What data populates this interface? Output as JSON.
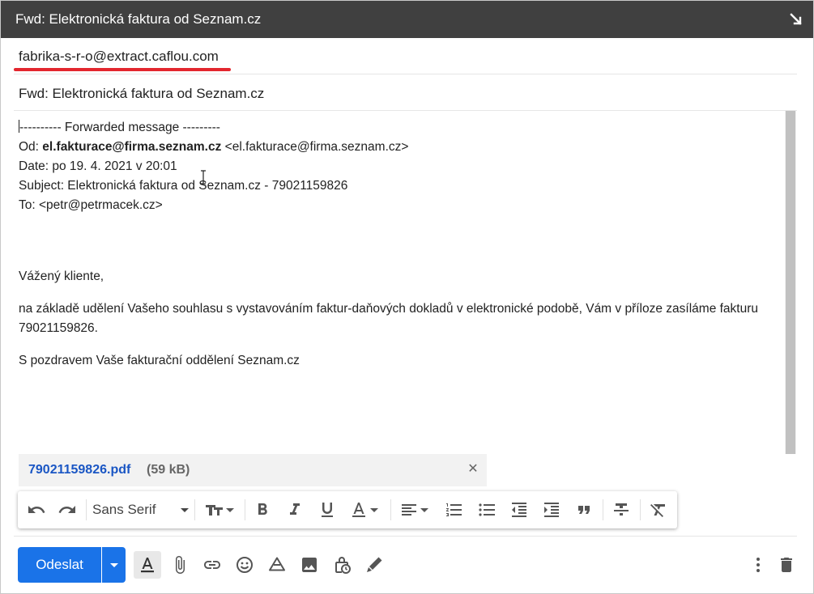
{
  "window": {
    "title": "Fwd: Elektronická faktura od Seznam.cz"
  },
  "recipient": {
    "value": "fabrika-s-r-o@extract.caflou.com"
  },
  "subject": {
    "value": "Fwd: Elektronická faktura od Seznam.cz"
  },
  "body": {
    "forward_header": "---------- Forwarded message ---------",
    "from_label": "Od:",
    "from_name": "el.fakturace@firma.seznam.cz",
    "from_email": "<el.fakturace@firma.seznam.cz>",
    "date_line": "Date: po 19. 4. 2021 v 20:01",
    "subject_line": "Subject: Elektronická faktura od Seznam.cz - 79021159826",
    "to_line": "To: <petr@petrmacek.cz>",
    "greeting": "Vážený kliente,",
    "paragraph": "na základě udělení Vašeho souhlasu s vystavováním faktur-daňových dokladů v elektronické podobě, Vám v příloze zasíláme fakturu 79021159826.",
    "closing": "S pozdravem Vaše fakturační oddělení Seznam.cz"
  },
  "attachment": {
    "name": "79021159826.pdf",
    "size": "(59 kB)"
  },
  "formatting": {
    "font": "Sans Serif"
  },
  "send": {
    "label": "Odeslat"
  },
  "colors": {
    "titlebar": "#404040",
    "send_button": "#1a73e8",
    "attachment_link": "#1a56c4",
    "red_underline": "#e3262e"
  }
}
